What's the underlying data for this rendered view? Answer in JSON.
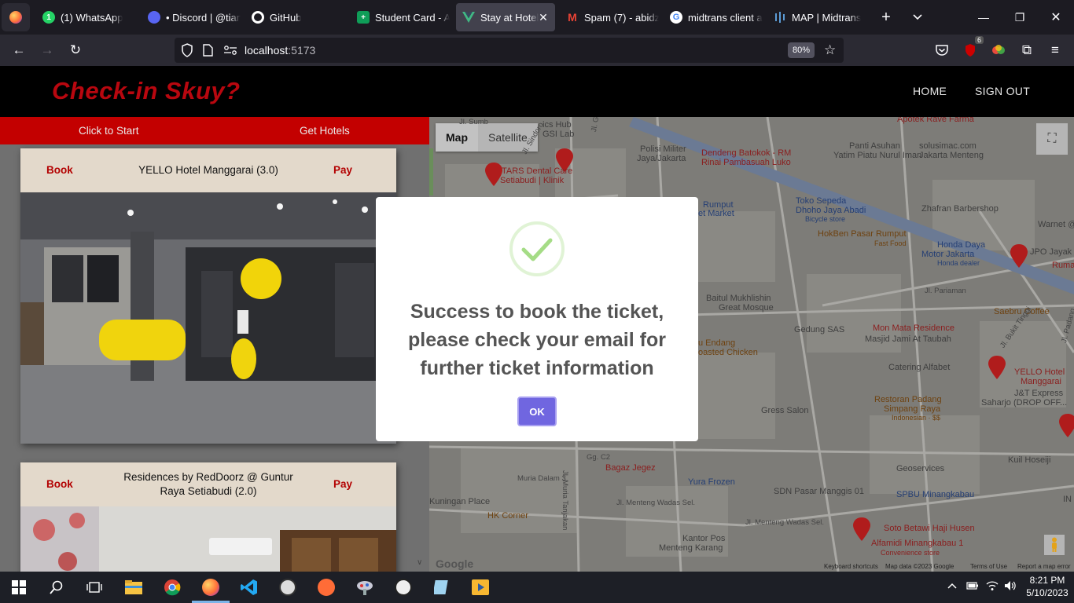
{
  "browser": {
    "tabs": [
      {
        "label": "(1) WhatsApp",
        "icon": "whatsapp-icon",
        "active": false
      },
      {
        "label": "• Discord | @tianI",
        "icon": "discord-icon",
        "active": false
      },
      {
        "label": "GitHub",
        "icon": "github-icon",
        "active": false
      },
      {
        "label": "Student Card - Al",
        "icon": "sheets-icon",
        "active": false
      },
      {
        "label": "Stay at Hotel",
        "icon": "vue-icon",
        "active": true
      },
      {
        "label": "Spam (7) - abidza",
        "icon": "gmail-icon",
        "active": false
      },
      {
        "label": "midtrans client a",
        "icon": "google-icon",
        "active": false
      },
      {
        "label": "MAP | Midtrans",
        "icon": "midtrans-icon",
        "active": false
      }
    ],
    "url_host": "localhost",
    "url_port": ":5173",
    "zoom": "80%",
    "extension_badge": "6"
  },
  "app": {
    "brand": "Check-in Skuy?",
    "nav": {
      "home": "HOME",
      "signout": "SIGN OUT"
    },
    "panel": {
      "start": "Click to Start",
      "get_hotels": "Get Hotels"
    },
    "hotels": [
      {
        "book": "Book",
        "pay": "Pay",
        "title": "YELLO Hotel Manggarai (3.0)"
      },
      {
        "book": "Book",
        "pay": "Pay",
        "title": "Residences by RedDoorz @ Guntur Raya Setiabudi (2.0)"
      }
    ]
  },
  "map": {
    "type_map": "Map",
    "type_satellite": "Satellite",
    "labels": {
      "apotek": "Apotek Rave Farma",
      "solusimac": "solusimac.com",
      "solusimac2": "Jakarta Menteng",
      "polisi": "Polisi Militer",
      "polisi2": "Jaya/Jakarta",
      "dendeng": "Dendeng Batokok - RM",
      "dendeng2": "Rinai Pambasuah Luko",
      "panti": "Panti Asuhan",
      "panti2": "Yatim Piatu Nurul Iman",
      "tars": "TARS Dental Care",
      "tars2": "Setiabudi | Klinik",
      "rumput": "Rumput",
      "rumput2": "et Market",
      "toko": "Toko Sepeda",
      "toko2": "Dhoho Jaya Abadi",
      "toko3": "Bicycle store",
      "zhafran": "Zhafran Barbershop",
      "warnet": "Warnet @",
      "hokben": "HokBen Pasar Rumput",
      "hokben2": "Fast Food",
      "honda": "Honda Daya",
      "honda2": "Motor Jakarta",
      "honda3": "Honda dealer",
      "jpo": "JPO Jayak",
      "ruma": "Ruma",
      "baitul": "Baitul Mukhlishin",
      "baitul2": "Great Mosque",
      "pariaman": "Jl. Pariaman",
      "saebru": "Saebru Coffee",
      "gedung": "Gedung SAS",
      "monmata": "Mon Mata Residence",
      "masjid": "Masjid Jami At Taubah",
      "chicken": "u Endang",
      "chicken2": "oasted Chicken",
      "catering": "Catering Alfabet",
      "yello": "YELLO Hotel",
      "yello2": "Manggarai",
      "jt": "J&T Express",
      "jt2": "Saharjo (DROP OFF...",
      "restoran": "Restoran Padang",
      "restoran2": "Simpang Raya",
      "restoran3": "Indonesian · $$",
      "gress": "Gress Salon",
      "geoservices": "Geoservices",
      "kuil": "Kuil Hoseiji",
      "bagaz": "Bagaz Jegez",
      "yura": "Yura Frozen",
      "sdn": "SDN Pasar Manggis 01",
      "spbu": "SPBU Minangkabau",
      "kuningan": "Kuningan Place",
      "hk": "HK Corner",
      "wadas": "Jl. Menteng Wadas Sel.",
      "wadas2": "Jl. Menteng Wadas Sel.",
      "kantorpos": "Kantor Pos",
      "kantorpos2": "Menteng Karang",
      "soto": "Soto Betawi Haji Husen",
      "alfamidi": "Alfamidi Minangkabau 1",
      "alfamidi2": "Convenience store",
      "muria": "Muria Dalam 3",
      "muriatanjakan": "Jl. Muria Tanjakan",
      "guntur": "Jl. Guntur",
      "sindoro": "Jl. Sindoro",
      "bukit": "Jl. Bukit Tinggi",
      "padang": "Jl. Padang",
      "g2": "Gg. C2",
      "sumbing": "Jl. Sumb",
      "ics": "ics Hub",
      "gsi": "GSI Lab",
      "in": "IN",
      "footer_keyboard": "Keyboard shortcuts",
      "footer_data": "Map data ©2023 Google",
      "footer_terms": "Terms of Use",
      "footer_report": "Report a map error",
      "google": "Google"
    }
  },
  "modal": {
    "message": "Success to book the ticket, please check your email for further ticket information",
    "ok": "OK"
  },
  "taskbar": {
    "time": "8:21 PM",
    "date": "5/10/2023"
  },
  "colors": {
    "brand_red": "#b8070f",
    "panel_red": "#c30000",
    "ok_purple": "#7066e0",
    "success_green": "#a5dc86"
  }
}
